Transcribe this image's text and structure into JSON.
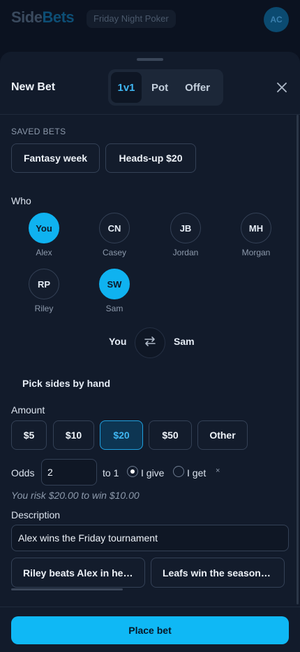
{
  "app": {
    "logo_part1": "Side",
    "logo_part2": "Bets",
    "group": "Friday Night Poker",
    "user_initials": "AC"
  },
  "sheet": {
    "title": "New Bet",
    "tabs": [
      {
        "label": "1v1",
        "active": true
      },
      {
        "label": "Pot"
      },
      {
        "label": "Offer"
      }
    ]
  },
  "saved": {
    "label": "SAVED BETS",
    "items": [
      "Fantasy week",
      "Heads-up $20"
    ]
  },
  "who": {
    "label": "Who",
    "people": [
      {
        "initials": "You",
        "name": "Alex",
        "selected": true
      },
      {
        "initials": "CN",
        "name": "Casey"
      },
      {
        "initials": "JB",
        "name": "Jordan"
      },
      {
        "initials": "MH",
        "name": "Morgan"
      },
      {
        "initials": "RP",
        "name": "Riley"
      },
      {
        "initials": "SW",
        "name": "Sam",
        "selected": true
      }
    ],
    "matchup_left": "You",
    "matchup_right": "Sam",
    "pick_sides": "Pick sides by hand"
  },
  "amount": {
    "label": "Amount",
    "options": [
      "$5",
      "$10",
      "$20",
      "$50",
      "Other"
    ],
    "selected": "$20"
  },
  "odds": {
    "label": "Odds",
    "value": "2",
    "to_one": "to 1",
    "i_give": "I give",
    "i_get": "I get",
    "clear": "×",
    "selected": "I give"
  },
  "risk_text": "You risk $20.00 to win $10.00",
  "description": {
    "label": "Description",
    "value": "Alex wins the Friday tournament",
    "suggestions": [
      "Riley beats Alex in heads-up",
      "Leafs win the season opener"
    ]
  },
  "footer": {
    "place_bet": "Place bet"
  },
  "colors": {
    "accent": "#0fb8f5",
    "sheet_bg": "#121b2b",
    "page_bg": "#0b1220"
  }
}
